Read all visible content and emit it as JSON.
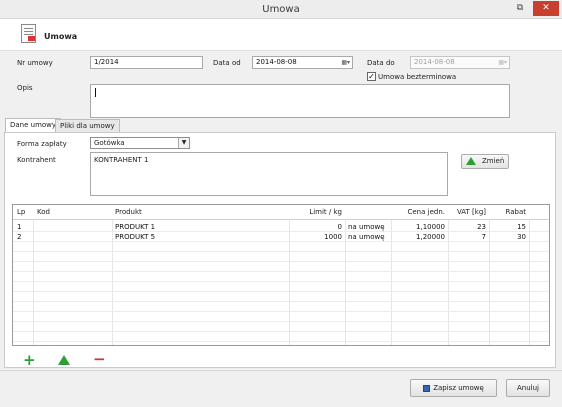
{
  "window": {
    "title": "Umowa",
    "close_glyph": "✕",
    "menu_glyph": "⧉"
  },
  "header": {
    "title": "Umowa"
  },
  "form": {
    "nr_umowy_label": "Nr umowy",
    "nr_umowy_value": "1/2014",
    "data_od_label": "Data od",
    "data_od_value": "2014-08-08",
    "data_do_label": "Data do",
    "data_do_value": "2014-08-08",
    "bezterminowa_label": "Umowa bezterminowa",
    "bezterminowa_checked": true,
    "opis_label": "Opis",
    "opis_value": ""
  },
  "tabs": [
    {
      "label": "Dane umowy",
      "active": true
    },
    {
      "label": "Pliki dla umowy",
      "active": false
    }
  ],
  "panel": {
    "forma_label": "Forma zapłaty",
    "forma_value": "Gotówka",
    "kontrahent_label": "Kontrahent",
    "kontrahent_value": "KONTRAHENT 1",
    "zmien_label": "Zmień"
  },
  "table": {
    "columns": [
      "Lp",
      "Kod",
      "Produkt",
      "Limit / kg",
      "",
      "Cena jedn.",
      "VAT [kg]",
      "Rabat"
    ],
    "rows": [
      [
        "1",
        "",
        "PRODUKT 1",
        "0",
        "na umowę",
        "1,10000",
        "23",
        "15"
      ],
      [
        "2",
        "",
        "PRODUKT 5",
        "1000",
        "na umowę",
        "1,20000",
        "7",
        "30"
      ]
    ]
  },
  "actions": {
    "add": "+",
    "remove": "−"
  },
  "footer": {
    "save_label": "Zapisz umowę",
    "cancel_label": "Anuluj"
  },
  "colors": {
    "close": "#c7402f",
    "add": "#2f9e35",
    "remove": "#d6332a",
    "accent_title": "#3a3a3a"
  }
}
